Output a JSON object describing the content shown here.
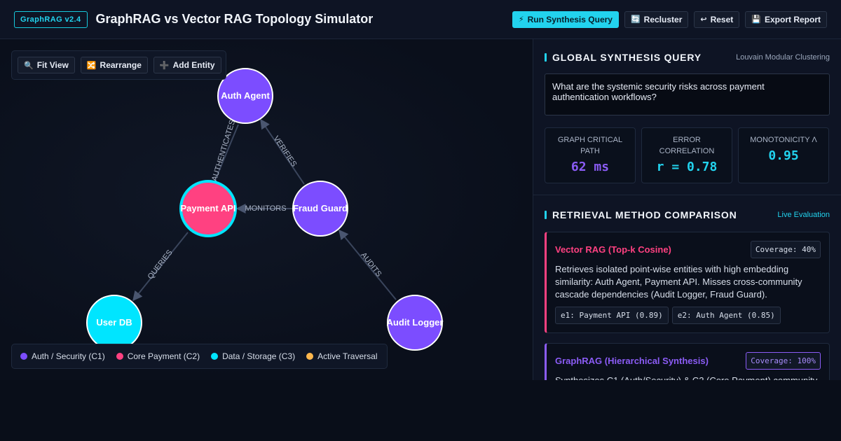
{
  "header": {
    "version": "GraphRAG v2.4",
    "title": "GraphRAG vs Vector RAG Topology Simulator",
    "actions": {
      "run": "Run Synthesis Query",
      "recluster": "Recluster",
      "reset": "Reset",
      "export": "Export Report"
    }
  },
  "toolbar": {
    "fit": "Fit View",
    "rearrange": "Rearrange",
    "add": "Add Entity"
  },
  "graph": {
    "nodes": {
      "auth": "Auth Agent",
      "payment": "Payment API",
      "fraud": "Fraud Guard",
      "userdb": "User DB",
      "audit": "Audit Logger"
    },
    "edges": {
      "authenticates": "AUTHENTICATES",
      "verifies": "VERIFIES",
      "monitors": "MONITORS",
      "queries": "QUERIES",
      "audits": "AUDITS"
    }
  },
  "legend": {
    "c1": "Auth / Security (C1)",
    "c2": "Core Payment (C2)",
    "c3": "Data / Storage (C3)",
    "active": "Active Traversal"
  },
  "colors": {
    "auth": "#7c4dff",
    "payment": "#ff4181",
    "data": "#00e5ff",
    "active": "#ffb74d",
    "accent": "#22d3ee"
  },
  "synthesis": {
    "title": "GLOBAL SYNTHESIS QUERY",
    "subtitle": "Louvain Modular Clustering",
    "query": "What are the systemic security risks across payment authentication workflows?",
    "metrics": {
      "path_label": "GRAPH CRITICAL PATH",
      "path_value": "62 ms",
      "corr_label": "ERROR CORRELATION",
      "corr_value": "r = 0.78",
      "mono_label": "MONOTONICITY Λ",
      "mono_value": "0.95"
    }
  },
  "comparison": {
    "title": "RETRIEVAL METHOD COMPARISON",
    "status": "Live Evaluation",
    "vector": {
      "title": "Vector RAG (Top-k Cosine)",
      "coverage": "Coverage: 40%",
      "desc": "Retrieves isolated point-wise entities with high embedding similarity: Auth Agent, Payment API. Misses cross-community cascade dependencies (Audit Logger, Fraud Guard).",
      "chip1": "e1: Payment API (0.89)",
      "chip2": "e2: Auth Agent (0.85)"
    },
    "graphrag": {
      "title": "GraphRAG (Hierarchical Synthesis)",
      "coverage": "Coverage: 100%",
      "desc": "Synthesizes C1 (Auth/Security) & C2 (Core Payment) community"
    }
  }
}
